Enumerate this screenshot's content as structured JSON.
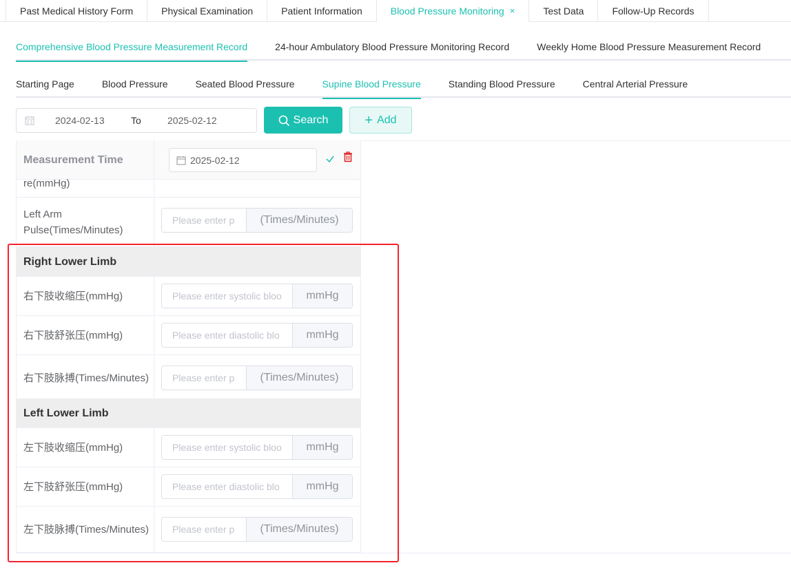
{
  "top_tabs": [
    {
      "label": "Past Medical History Form"
    },
    {
      "label": "Physical Examination"
    },
    {
      "label": "Patient Information"
    },
    {
      "label": "Blood Pressure Monitoring",
      "active": true,
      "close": "×"
    },
    {
      "label": "Test Data"
    },
    {
      "label": "Follow-Up Records"
    }
  ],
  "sub_tabs": [
    {
      "label": "Comprehensive Blood Pressure Measurement Record",
      "active": true
    },
    {
      "label": "24-hour Ambulatory Blood Pressure Monitoring Record"
    },
    {
      "label": "Weekly Home Blood Pressure Measurement Record"
    }
  ],
  "third_tabs": [
    {
      "label": "Starting Page"
    },
    {
      "label": "Blood Pressure"
    },
    {
      "label": "Seated Blood Pressure"
    },
    {
      "label": "Supine Blood Pressure",
      "active": true
    },
    {
      "label": "Standing Blood Pressure"
    },
    {
      "label": "Central Arterial Pressure"
    }
  ],
  "toolbar": {
    "date_start": "2024-02-13",
    "date_to": "To",
    "date_end": "2025-02-12",
    "search_label": "Search",
    "add_label": "Add"
  },
  "table": {
    "header_label": "Measurement Time",
    "header_date": "2025-02-12",
    "cutoff_label": "re(mmHg)",
    "left_arm_pulse": {
      "label": "Left Arm Pulse(Times/Minutes)",
      "placeholder": "Please enter p",
      "unit": "(Times/Minutes)"
    },
    "right_lower_limb": {
      "section": "Right Lower Limb",
      "systolic": {
        "label": "右下肢收缩压(mmHg)",
        "placeholder": "Please enter systolic bloo",
        "unit": "mmHg"
      },
      "diastolic": {
        "label": "右下肢舒张压(mmHg)",
        "placeholder": "Please enter diastolic blo",
        "unit": "mmHg"
      },
      "pulse": {
        "label": "右下肢脉搏(Times/Minutes)",
        "placeholder": "Please enter p",
        "unit": "(Times/Minutes)"
      }
    },
    "left_lower_limb": {
      "section": "Left Lower Limb",
      "systolic": {
        "label": "左下肢收缩压(mmHg)",
        "placeholder": "Please enter systolic bloo",
        "unit": "mmHg"
      },
      "diastolic": {
        "label": "左下肢舒张压(mmHg)",
        "placeholder": "Please enter diastolic blo",
        "unit": "mmHg"
      },
      "pulse": {
        "label": "左下肢脉搏(Times/Minutes)",
        "placeholder": "Please enter p",
        "unit": "(Times/Minutes)"
      }
    }
  },
  "colors": {
    "accent": "#1cc0b1",
    "highlight": "#f5222d",
    "danger": "#e02020"
  }
}
